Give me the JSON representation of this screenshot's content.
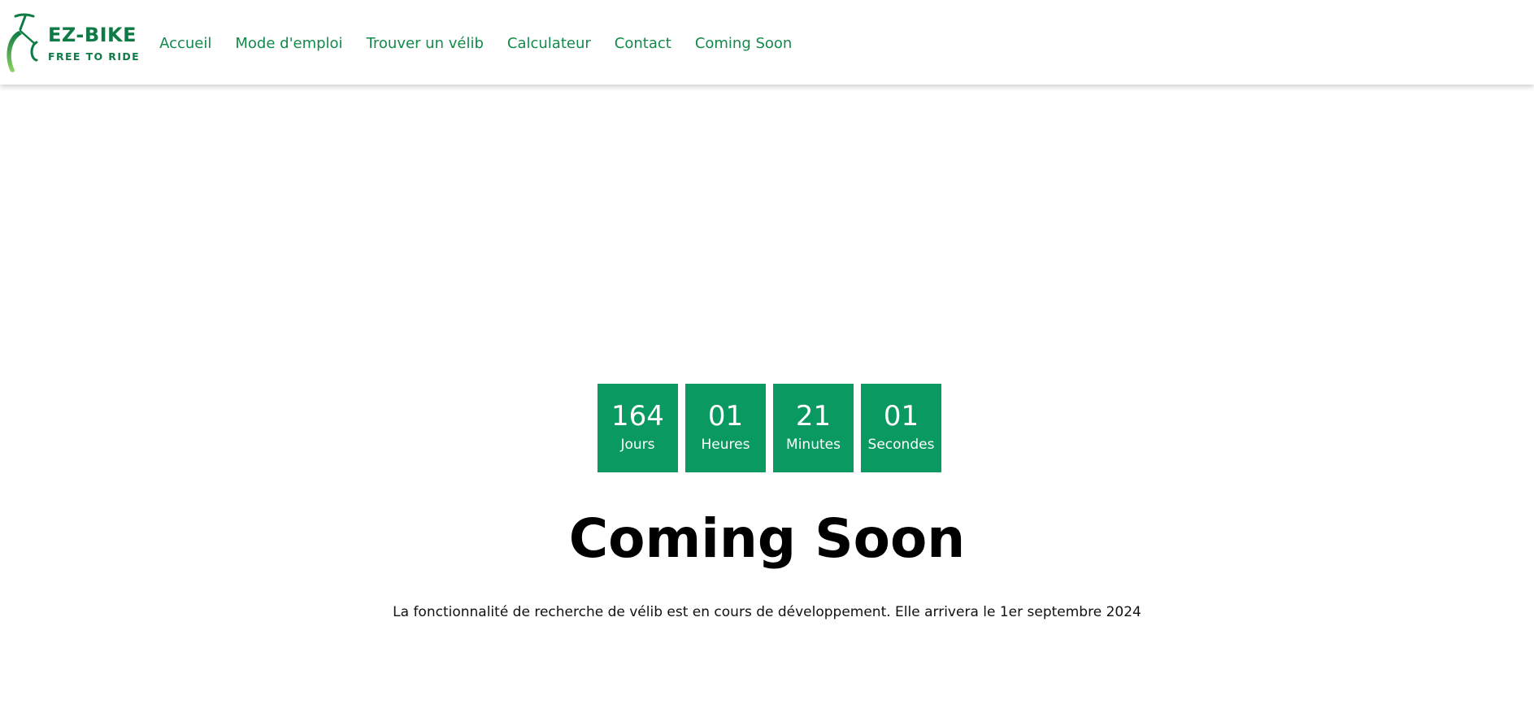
{
  "brand": {
    "title": "EZ-BIKE",
    "tagline": "FREE TO RIDE",
    "logo_icon": "bicycle-icon",
    "color": "#0e7a45",
    "accent_light": "#8dd35f"
  },
  "nav": {
    "items": [
      {
        "label": "Accueil"
      },
      {
        "label": "Mode d'emploi"
      },
      {
        "label": "Trouver un vélib"
      },
      {
        "label": "Calculateur"
      },
      {
        "label": "Contact"
      },
      {
        "label": "Coming Soon"
      }
    ],
    "color": "#128a4a"
  },
  "countdown": {
    "box_color": "#0a9960",
    "units": [
      {
        "value": "164",
        "label": "Jours"
      },
      {
        "value": "01",
        "label": "Heures"
      },
      {
        "value": "21",
        "label": "Minutes"
      },
      {
        "value": "01",
        "label": "Secondes"
      }
    ]
  },
  "main": {
    "heading": "Coming Soon",
    "description": "La fonctionnalité de recherche de vélib est en cours de développement. Elle arrivera le 1er septembre 2024"
  }
}
